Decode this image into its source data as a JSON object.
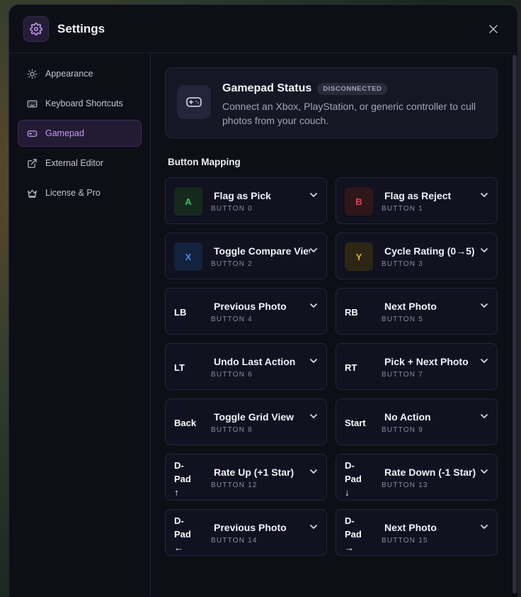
{
  "header": {
    "title": "Settings",
    "icon": "gear-icon",
    "close_icon": "close-icon"
  },
  "sidebar": {
    "items": [
      {
        "label": "Appearance",
        "icon": "sun-icon",
        "active": false
      },
      {
        "label": "Keyboard Shortcuts",
        "icon": "keyboard-icon",
        "active": false
      },
      {
        "label": "Gamepad",
        "icon": "gamepad-icon",
        "active": true
      },
      {
        "label": "External Editor",
        "icon": "external-link-icon",
        "active": false
      },
      {
        "label": "License & Pro",
        "icon": "crown-icon",
        "active": false
      }
    ]
  },
  "status": {
    "title": "Gamepad Status",
    "badge": "DISCONNECTED",
    "description": "Connect an Xbox, PlayStation, or generic controller to cull photos from your couch."
  },
  "mapping": {
    "title": "Button Mapping",
    "items": [
      {
        "key": "A",
        "action": "Flag as Pick",
        "button": "BUTTON 0"
      },
      {
        "key": "B",
        "action": "Flag as Reject",
        "button": "BUTTON 1"
      },
      {
        "key": "X",
        "action": "Toggle Compare View",
        "button": "BUTTON 2"
      },
      {
        "key": "Y",
        "action": "Cycle Rating (0→5)",
        "button": "BUTTON 3"
      },
      {
        "key": "LB",
        "action": "Previous Photo",
        "button": "BUTTON 4"
      },
      {
        "key": "RB",
        "action": "Next Photo",
        "button": "BUTTON 5"
      },
      {
        "key": "LT",
        "action": "Undo Last Action",
        "button": "BUTTON 6"
      },
      {
        "key": "RT",
        "action": "Pick + Next Photo",
        "button": "BUTTON 7"
      },
      {
        "key": "Back",
        "action": "Toggle Grid View",
        "button": "BUTTON 8"
      },
      {
        "key": "Start",
        "action": "No Action",
        "button": "BUTTON 9"
      },
      {
        "key": "D-\nPad\n↑",
        "action": "Rate Up (+1 Star)",
        "button": "BUTTON 12"
      },
      {
        "key": "D-\nPad\n↓",
        "action": "Rate Down (-1 Star)",
        "button": "BUTTON 13"
      },
      {
        "key": "D-\nPad\n←",
        "action": "Previous Photo",
        "button": "BUTTON 14"
      },
      {
        "key": "D-\nPad\n→",
        "action": "Next Photo",
        "button": "BUTTON 15"
      }
    ]
  },
  "colors": {
    "accent": "#c79cf7",
    "key_A_bg": "#15291d",
    "key_A_fg": "#3fbf6a",
    "key_B_bg": "#2e1619",
    "key_B_fg": "#e0484e",
    "key_X_bg": "#13223d",
    "key_X_fg": "#3d8ef0",
    "key_Y_bg": "#2e2614",
    "key_Y_fg": "#e6b32e"
  }
}
